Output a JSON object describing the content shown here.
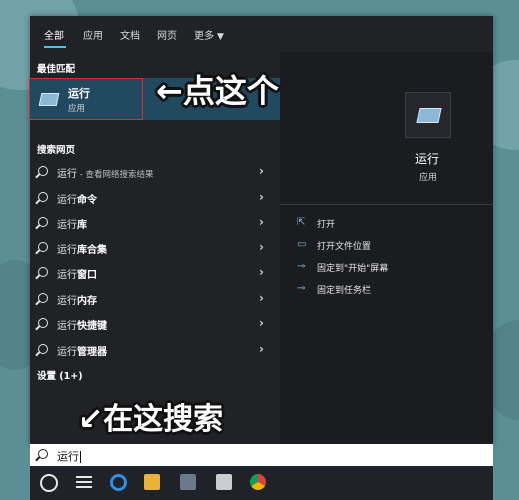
{
  "tabs": [
    "全部",
    "应用",
    "文档",
    "网页",
    "更多"
  ],
  "best_match": {
    "section_label": "最佳匹配",
    "title": "运行",
    "subtitle": "应用"
  },
  "web_search": {
    "section_label": "搜索网页",
    "rows": [
      {
        "prefix": "运行",
        "suffix": " - 查看网络搜索结果"
      },
      {
        "prefix": "运行",
        "suffix": "命令"
      },
      {
        "prefix": "运行",
        "suffix": "库"
      },
      {
        "prefix": "运行",
        "suffix": "库合集"
      },
      {
        "prefix": "运行",
        "suffix": "窗口"
      },
      {
        "prefix": "运行",
        "suffix": "内存"
      },
      {
        "prefix": "运行",
        "suffix": "快捷键"
      },
      {
        "prefix": "运行",
        "suffix": "管理器"
      }
    ]
  },
  "settings_label": "设置 (1+)",
  "detail": {
    "title": "运行",
    "subtitle": "应用",
    "actions": [
      {
        "label": "打开",
        "icon": "open-icon"
      },
      {
        "label": "打开文件位置",
        "icon": "folder-open-icon"
      },
      {
        "label": "固定到\"开始\"屏幕",
        "icon": "pin-icon"
      },
      {
        "label": "固定到任务栏",
        "icon": "pin-icon"
      }
    ]
  },
  "search": {
    "value": "运行"
  },
  "annotations": {
    "click_this": "←点这个",
    "search_here": "↙在这搜索"
  },
  "colors": {
    "panel": "#202226",
    "highlight": "#21495f",
    "accent": "#4cc2ff",
    "annotation_border": "#e02b2b"
  }
}
